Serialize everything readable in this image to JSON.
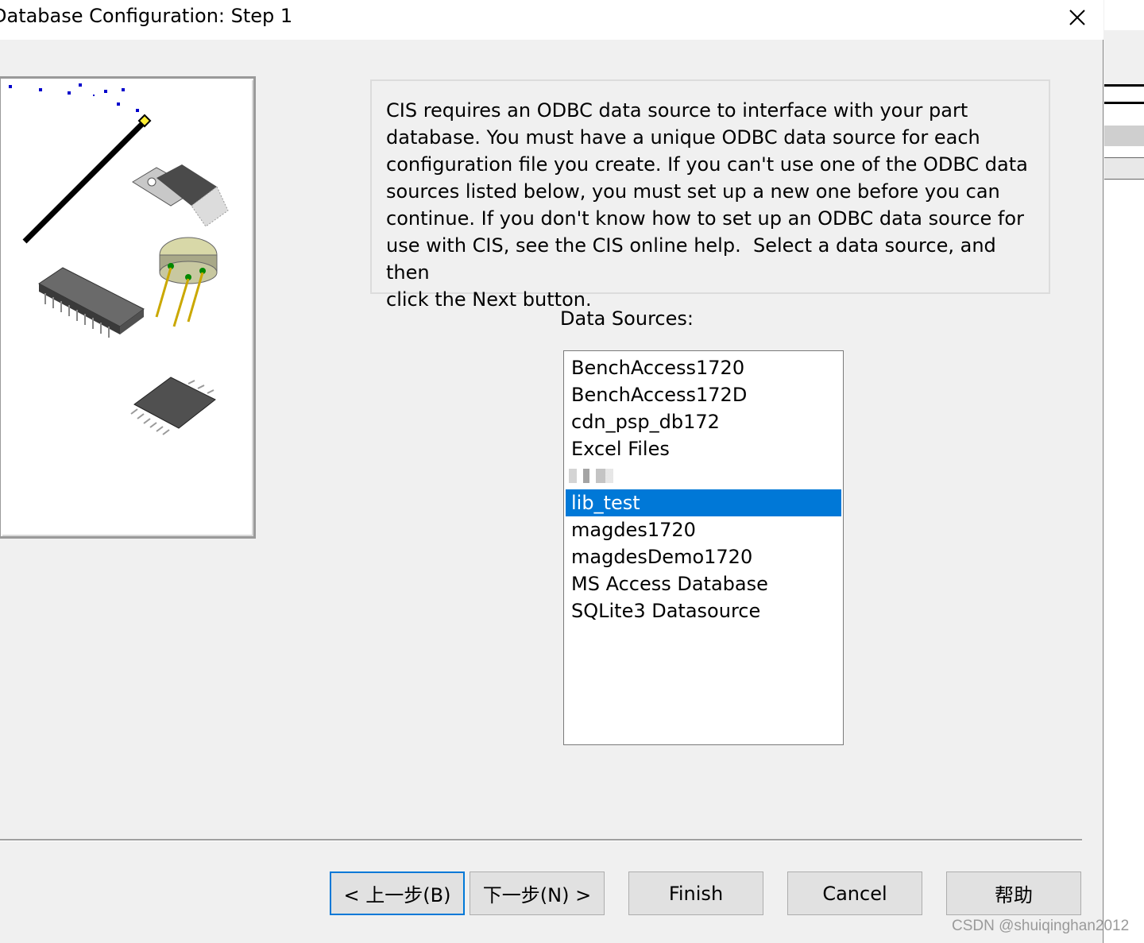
{
  "window": {
    "title": "Database Configuration: Step 1",
    "close_label": "✕"
  },
  "info": {
    "text": "CIS requires an ODBC data source to interface with your part\ndatabase. You must have a unique ODBC data source for each\nconfiguration file you create. If you can't use one of the ODBC data\nsources listed below, you must set up a new one before you can\ncontinue. If you don't know how to set up an ODBC data source for\nuse with CIS, see the CIS online help.  Select a data source, and then\nclick the Next button."
  },
  "data_sources": {
    "label": "Data Sources:",
    "items": [
      {
        "label": "BenchAccess1720"
      },
      {
        "label": "BenchAccess172D"
      },
      {
        "label": "cdn_psp_db172"
      },
      {
        "label": "Excel Files"
      },
      {
        "label": "",
        "obscured": true
      },
      {
        "label": "lib_test",
        "selected": true
      },
      {
        "label": "magdes1720"
      },
      {
        "label": "magdesDemo1720"
      },
      {
        "label": "MS Access Database"
      },
      {
        "label": "SQLite3 Datasource"
      }
    ],
    "selected": "lib_test"
  },
  "buttons": {
    "back": "< 上一步(B)",
    "next": "下一步(N) >",
    "finish": "Finish",
    "cancel": "Cancel",
    "help": "帮助"
  },
  "watermark": "CSDN @shuiqinghan2012",
  "colors": {
    "selection": "#0078d7",
    "dialog_bg": "#f0f0f0"
  },
  "icons": [
    "close-icon",
    "magic-wand-icon",
    "to220-transistor-icon",
    "to5-can-transistor-icon",
    "dip-chip-icon",
    "soic-chip-icon"
  ]
}
